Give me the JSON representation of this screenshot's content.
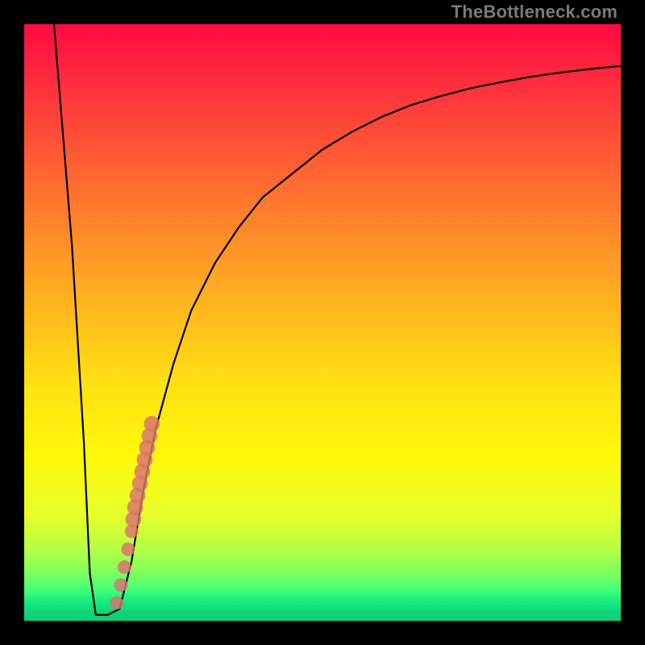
{
  "attribution": "TheBottleneck.com",
  "colors": {
    "dot": "#d8736e",
    "curve": "#000000"
  },
  "chart_data": {
    "type": "line",
    "title": "",
    "xlabel": "",
    "ylabel": "",
    "xlim": [
      0,
      100
    ],
    "ylim": [
      0,
      100
    ],
    "grid": false,
    "legend": false,
    "series": [
      {
        "name": "bottleneck-curve",
        "x": [
          5,
          8,
          10,
          11,
          12,
          14,
          16,
          18,
          20,
          22,
          25,
          28,
          32,
          36,
          40,
          45,
          50,
          55,
          60,
          65,
          70,
          75,
          80,
          85,
          90,
          95,
          100
        ],
        "y": [
          100,
          63,
          30,
          8,
          1,
          1,
          2,
          10,
          22,
          32,
          43,
          52,
          60,
          66,
          71,
          75,
          79,
          82,
          84.5,
          86.5,
          88,
          89.3,
          90.3,
          91.2,
          91.9,
          92.5,
          93
        ]
      }
    ],
    "highlight_points": {
      "name": "highlighted-range",
      "points": [
        {
          "x": 15.5,
          "y": 3,
          "r": 1.2
        },
        {
          "x": 16.2,
          "y": 6,
          "r": 1.2
        },
        {
          "x": 16.8,
          "y": 9,
          "r": 1.2
        },
        {
          "x": 17.4,
          "y": 12,
          "r": 1.2
        },
        {
          "x": 18.0,
          "y": 15,
          "r": 1.2
        },
        {
          "x": 18.3,
          "y": 17,
          "r": 1.6
        },
        {
          "x": 18.6,
          "y": 19,
          "r": 1.6
        },
        {
          "x": 19.0,
          "y": 21,
          "r": 1.6
        },
        {
          "x": 19.4,
          "y": 23,
          "r": 1.6
        },
        {
          "x": 19.8,
          "y": 25,
          "r": 1.6
        },
        {
          "x": 20.2,
          "y": 27,
          "r": 1.6
        },
        {
          "x": 20.6,
          "y": 29,
          "r": 1.6
        },
        {
          "x": 21.0,
          "y": 31,
          "r": 1.6
        },
        {
          "x": 21.4,
          "y": 33,
          "r": 1.6
        }
      ]
    }
  }
}
